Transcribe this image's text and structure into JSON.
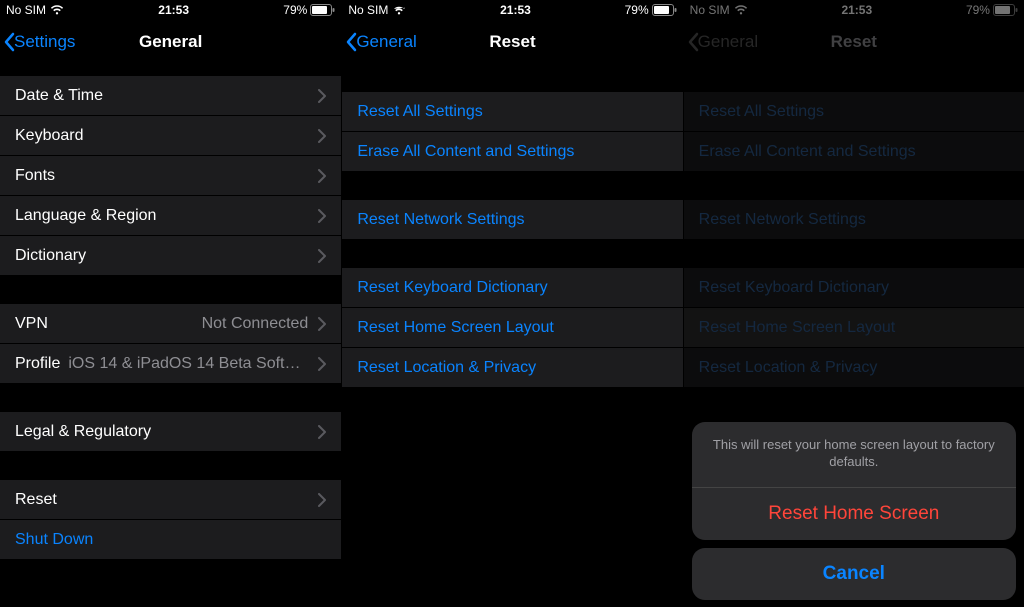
{
  "status": {
    "left": "No SIM",
    "time": "21:53",
    "battery": "79%"
  },
  "col1": {
    "back": "Settings",
    "title": "General",
    "rows": {
      "datetime": "Date & Time",
      "keyboard": "Keyboard",
      "fonts": "Fonts",
      "lang": "Language & Region",
      "dict": "Dictionary",
      "vpn": "VPN",
      "vpn_value": "Not Connected",
      "profile": "Profile",
      "profile_value": "iOS 14 & iPadOS 14 Beta Softwar...",
      "legal": "Legal & Regulatory",
      "reset": "Reset",
      "shutdown": "Shut Down"
    }
  },
  "col2": {
    "back": "General",
    "title": "Reset",
    "rows": {
      "all": "Reset All Settings",
      "erase": "Erase All Content and Settings",
      "network": "Reset Network Settings",
      "keyboard": "Reset Keyboard Dictionary",
      "home": "Reset Home Screen Layout",
      "location": "Reset Location & Privacy"
    }
  },
  "col3": {
    "back": "General",
    "title": "Reset",
    "sheet": {
      "message": "This will reset your home screen layout to factory defaults.",
      "action": "Reset Home Screen",
      "cancel": "Cancel"
    }
  }
}
